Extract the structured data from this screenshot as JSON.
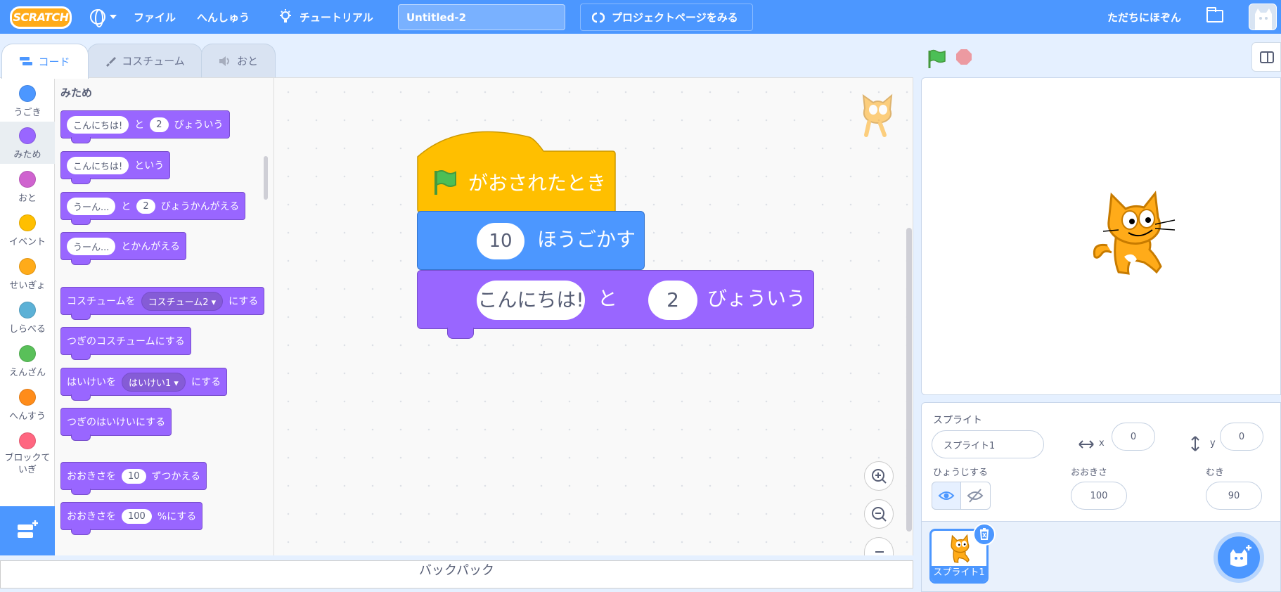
{
  "menubar": {
    "logo": "SCRATCH",
    "file": "ファイル",
    "edit": "へんしゅう",
    "tutorials": "チュートリアル",
    "project_title": "Untitled-2",
    "see_project_page": "プロジェクトページをみる",
    "user_name": "ただちにほぞん"
  },
  "tabs": {
    "code": "コード",
    "costumes": "コスチューム",
    "sounds": "おと"
  },
  "categories": [
    {
      "label": "うごき",
      "color": "#4c97ff"
    },
    {
      "label": "みため",
      "color": "#9966ff"
    },
    {
      "label": "おと",
      "color": "#cf63cf"
    },
    {
      "label": "イベント",
      "color": "#ffbf00"
    },
    {
      "label": "せいぎょ",
      "color": "#ffab19"
    },
    {
      "label": "しらべる",
      "color": "#5cb1d6"
    },
    {
      "label": "えんざん",
      "color": "#59c059"
    },
    {
      "label": "へんすう",
      "color": "#ff8c1a"
    },
    {
      "label": "ブロックて\nいぎ",
      "color": "#ff6680"
    }
  ],
  "palette": {
    "heading": "みため",
    "b1": {
      "input": "こんにちは!",
      "to": "と",
      "num": "2",
      "suffix": "びょういう"
    },
    "b2": {
      "input": "こんにちは!",
      "suffix": "という"
    },
    "b3": {
      "input": "うーん...",
      "to": "と",
      "num": "2",
      "suffix": "びょうかんがえる"
    },
    "b4": {
      "input": "うーん...",
      "suffix": "とかんがえる"
    },
    "b5": {
      "prefix": "コスチュームを",
      "dd": "コスチューム2",
      "suffix": "にする"
    },
    "b6": {
      "label": "つぎのコスチュームにする"
    },
    "b7": {
      "prefix": "はいけいを",
      "dd": "はいけい1",
      "suffix": "にする"
    },
    "b8": {
      "label": "つぎのはいけいにする"
    },
    "b9": {
      "prefix": "おおきさを",
      "num": "10",
      "suffix": "ずつかえる"
    },
    "b10": {
      "prefix": "おおきさを",
      "num": "100",
      "suffix": "%にする"
    }
  },
  "script": {
    "hat_label": "がおされたとき",
    "move_steps": "10",
    "move_label": "ほうごかす",
    "say_text": "こんにちは!",
    "say_to": "と",
    "say_secs": "2",
    "say_suffix": "びょういう"
  },
  "backpack": "バックパック",
  "sprite_info": {
    "sprite_label": "スプライト",
    "sprite_name": "スプライト1",
    "x_label": "x",
    "x": "0",
    "y_label": "y",
    "y": "0",
    "show_label": "ひょうじする",
    "size_label": "おおきさ",
    "size": "100",
    "direction_label": "むき",
    "direction": "90"
  },
  "sprite_list": [
    {
      "name": "スプライト1"
    }
  ]
}
